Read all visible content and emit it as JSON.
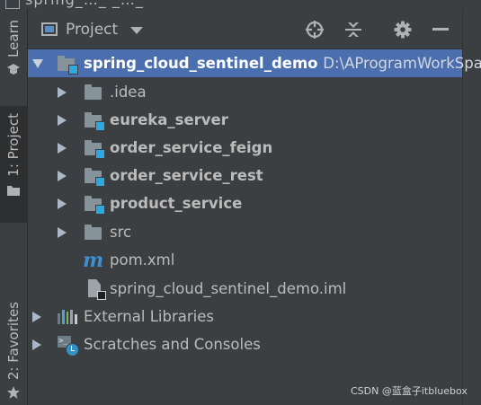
{
  "titlebar": {
    "fragment": "spring_…_ _…_"
  },
  "tool_strip": {
    "learn_label": "Learn",
    "project_label": "1: Project",
    "favorites_label": "2: Favorites"
  },
  "panel": {
    "title": "Project",
    "buttons": [
      "locate-icon",
      "collapse-all-icon",
      "gear-icon",
      "minimize-icon"
    ]
  },
  "tree": {
    "root": {
      "name": "spring_cloud_sentinel_demo",
      "path": "D:\\AProgramWorkSpa"
    },
    "items": [
      {
        "label": ".idea",
        "type": "folder",
        "bold": false
      },
      {
        "label": "eureka_server",
        "type": "module",
        "bold": true
      },
      {
        "label": "order_service_feign",
        "type": "module",
        "bold": true
      },
      {
        "label": "order_service_rest",
        "type": "module",
        "bold": true
      },
      {
        "label": "product_service",
        "type": "module",
        "bold": true
      },
      {
        "label": "src",
        "type": "folder",
        "bold": false
      },
      {
        "label": "pom.xml",
        "type": "maven-file"
      },
      {
        "label": "spring_cloud_sentinel_demo.iml",
        "type": "iml-file"
      }
    ],
    "external_libraries": "External Libraries",
    "scratches": "Scratches and Consoles"
  },
  "watermark": "CSDN @蓝盒子itbluebox",
  "colors": {
    "background": "#3c3f41",
    "selection": "#4b6eaf",
    "folder": "#87939a",
    "module_badge": "#2fa8e0",
    "maven": "#3d8fd1"
  }
}
